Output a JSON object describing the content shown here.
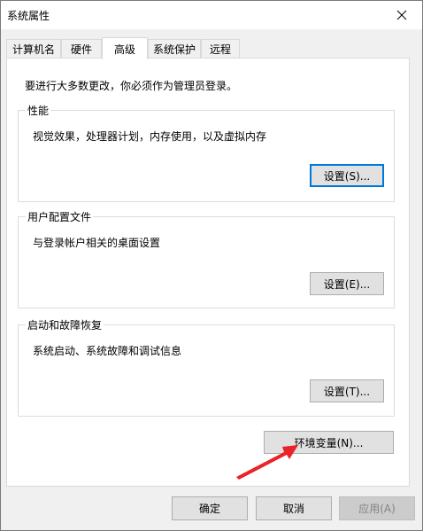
{
  "window": {
    "title": "系统属性"
  },
  "tabs": [
    {
      "label": "计算机名"
    },
    {
      "label": "硬件"
    },
    {
      "label": "高级"
    },
    {
      "label": "系统保护"
    },
    {
      "label": "远程"
    }
  ],
  "advanced": {
    "admin_note": "要进行大多数更改，你必须作为管理员登录。",
    "performance": {
      "label": "性能",
      "desc": "视觉效果，处理器计划，内存使用，以及虚拟内存",
      "button": "设置(S)..."
    },
    "user_profiles": {
      "label": "用户配置文件",
      "desc": "与登录帐户相关的桌面设置",
      "button": "设置(E)..."
    },
    "startup_recovery": {
      "label": "启动和故障恢复",
      "desc": "系统启动、系统故障和调试信息",
      "button": "设置(T)..."
    },
    "env_vars_button": "环境变量(N)..."
  },
  "footer": {
    "ok": "确定",
    "cancel": "取消",
    "apply": "应用(A)"
  },
  "colors": {
    "focus_border": "#0078d7",
    "annotation_arrow": "#e8232a"
  }
}
